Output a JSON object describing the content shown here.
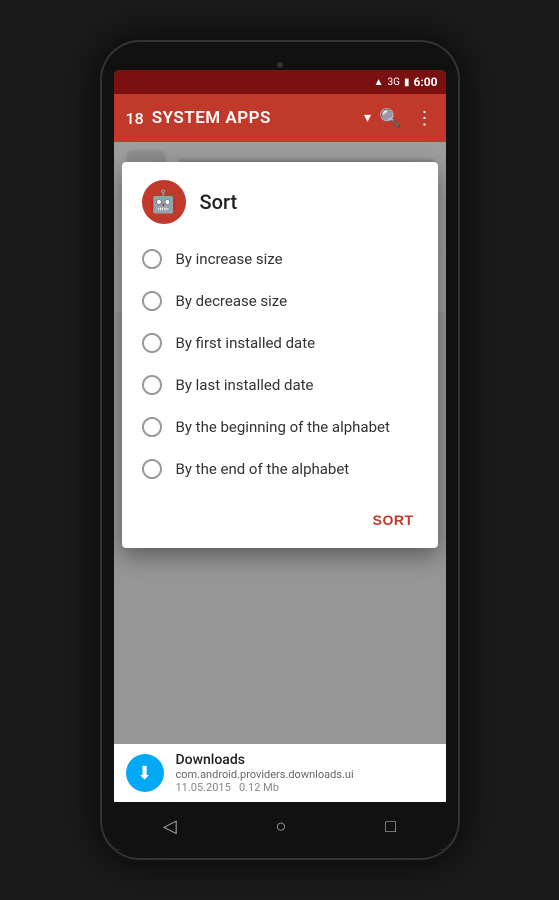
{
  "phone": {
    "status_bar": {
      "time": "6:00",
      "wifi": "▲",
      "signal": "3G",
      "battery": "▮"
    },
    "app_bar": {
      "count": "18",
      "title": "SYSTEM APPS",
      "search_label": "Search",
      "more_label": "More options"
    },
    "dialog": {
      "title": "Sort",
      "icon": "🤖",
      "options": [
        {
          "id": "increase_size",
          "label": "By increase size",
          "selected": false
        },
        {
          "id": "decrease_size",
          "label": "By decrease size",
          "selected": false
        },
        {
          "id": "first_installed",
          "label": "By first installed date",
          "selected": false
        },
        {
          "id": "last_installed",
          "label": "By last installed date",
          "selected": false
        },
        {
          "id": "alpha_begin",
          "label": "By the beginning of the alphabet",
          "selected": false
        },
        {
          "id": "alpha_end",
          "label": "By the end of the alphabet",
          "selected": false
        }
      ],
      "sort_button_label": "SORT"
    },
    "bottom_bar": {
      "app_name": "Downloads",
      "package": "com.android.providers.downloads.ui",
      "date": "11.05.2015",
      "size": "0.12 Mb"
    },
    "nav_bar": {
      "back_label": "◁",
      "home_label": "○",
      "recents_label": "□"
    }
  }
}
